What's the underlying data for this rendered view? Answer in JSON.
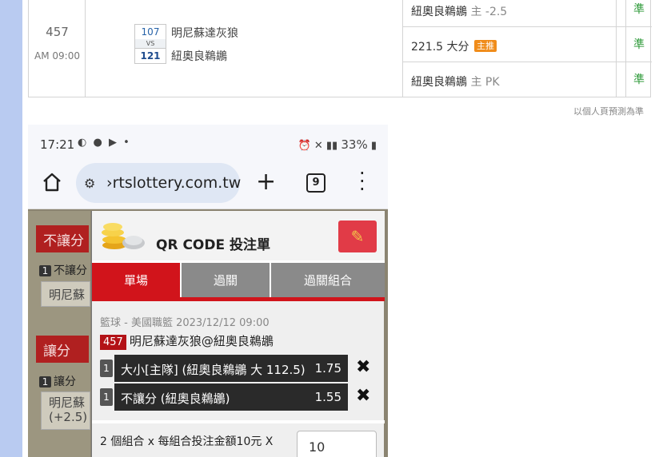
{
  "match": {
    "game_no": "457",
    "time": "AM 09:00",
    "away": {
      "num": "107",
      "name": "明尼蘇達灰狼"
    },
    "vs": "VS",
    "home": {
      "num": "121",
      "name": "紐奧良鵜鶘"
    },
    "odds": [
      {
        "team": "紐奧良鵜鶘",
        "tag": "主 -2.5",
        "mark": "準"
      },
      {
        "team": "221.5 大分",
        "tag": "主推",
        "mark": "準"
      },
      {
        "team": "紐奧良鵜鶘",
        "tag": "主 PK",
        "mark": "準"
      }
    ],
    "note": "以個人頁預測為準"
  },
  "phone": {
    "status_time": "17:21",
    "status_battery": "33%",
    "url": "›rtslottery.com.tw",
    "tabs_count": "9",
    "background": {
      "tab1": "不讓分",
      "row1_num": "1",
      "row1_text": "不讓分",
      "box1": "明尼蘇",
      "tab2": "讓分",
      "row2_num": "1",
      "row2_text": "讓分",
      "box2_line1": "明尼蘇",
      "box2_line2": "(+2.5)"
    },
    "qr": {
      "title": "QR CODE 投注單",
      "tabs": [
        "單場",
        "過關",
        "過關組合"
      ],
      "league": "籃球 - 美國職籃 2023/12/12 09:00",
      "match_no": "457",
      "match_title": "明尼蘇達灰狼@紐奧良鵜鶘",
      "bets": [
        {
          "num": "1",
          "label": "大小[主隊] (紐奧良鵜鶘 大 112.5)",
          "odd": "1.75"
        },
        {
          "num": "1",
          "label": "不讓分 (紐奧良鵜鶘)",
          "odd": "1.55"
        }
      ],
      "combo_text": "2 個組合 x 每組合投注金額10元 X",
      "amount": "10"
    }
  }
}
